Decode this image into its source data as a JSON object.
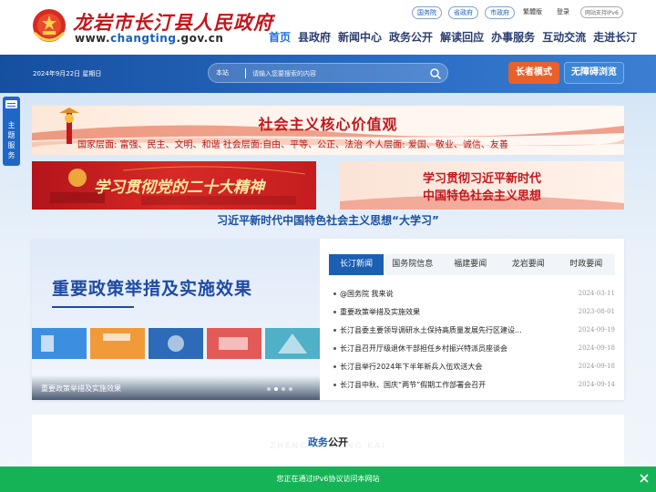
{
  "header": {
    "site_title": "龙岩市长汀县人民政府",
    "domain_prefix": "www.",
    "domain_accent": "changting",
    "domain_suffix": ".gov.cn",
    "top_links": [
      "国务院",
      "省政府",
      "市政府"
    ],
    "traditional": "繁體版",
    "login": "登录",
    "ipv6": "网站支持IPv6",
    "nav": [
      "首页",
      "县政府",
      "新闻中心",
      "政务公开",
      "解读回应",
      "办事服务",
      "互动交流",
      "走进长汀"
    ]
  },
  "band": {
    "date": "2024年9月22日 星期日",
    "search_scope": "本站",
    "search_placeholder": "请输入您要搜索的内容",
    "elder_mode": "长者模式",
    "accessible": "无障碍浏览"
  },
  "side_tab": {
    "label": "主题服务"
  },
  "banners": {
    "core_title": "社会主义核心价值观",
    "core_line": "国家层面: 富强、民主、文明、和谐   社会层面:自由、平等、公正、法治   个人层面: 爱国、敬业、诚信、友善",
    "b20": "学习贯彻党的二十大精神",
    "xi_line1": "学习贯彻习近平新时代",
    "xi_line2": "中国特色社会主义思想",
    "study": "习近平新时代中国特色社会主义思想“大学习”"
  },
  "carousel": {
    "headline": "重要政策举措及实施效果",
    "caption": "重要政策举措及实施效果"
  },
  "news": {
    "tabs": [
      "长汀新闻",
      "国务院信息",
      "福建要闻",
      "龙岩要闻",
      "时政要闻"
    ],
    "items": [
      {
        "title": "@国务院 我来说",
        "date": "2024-03-11"
      },
      {
        "title": "重要政策举措及实施效果",
        "date": "2023-08-01"
      },
      {
        "title": "长汀县委主要领导调研水土保持高质量发展先行区建设...",
        "date": "2024-09-19"
      },
      {
        "title": "长汀县召开厅级退休干部担任乡村振兴特派员座谈会",
        "date": "2024-09-18"
      },
      {
        "title": "长汀县举行2024年下半年新兵入伍欢送大会",
        "date": "2024-09-18"
      },
      {
        "title": "长汀县中秋、国庆“两节”假期工作部署会召开",
        "date": "2024-09-14"
      }
    ]
  },
  "affairs": {
    "title_hl": "政务",
    "title_rest": "公开",
    "watermark": "ZHENGWU GONG KAI"
  },
  "notice": {
    "text": "您正在通过IPv6协议访问本网站"
  },
  "colors": {
    "brand_red": "#c4161c",
    "brand_blue": "#1b5fb3",
    "notice_green": "#16b356",
    "elder_orange": "#e8612c"
  }
}
